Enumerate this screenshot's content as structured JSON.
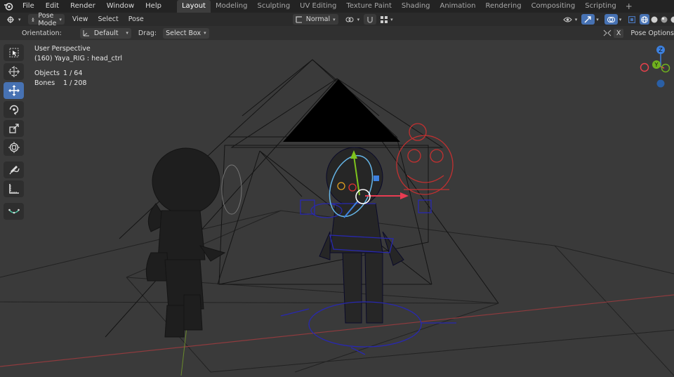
{
  "topbar": {
    "menus": [
      "File",
      "Edit",
      "Render",
      "Window",
      "Help"
    ],
    "tabs": [
      {
        "label": "Layout",
        "active": true
      },
      {
        "label": "Modeling",
        "active": false
      },
      {
        "label": "Sculpting",
        "active": false
      },
      {
        "label": "UV Editing",
        "active": false
      },
      {
        "label": "Texture Paint",
        "active": false
      },
      {
        "label": "Shading",
        "active": false
      },
      {
        "label": "Animation",
        "active": false
      },
      {
        "label": "Rendering",
        "active": false
      },
      {
        "label": "Compositing",
        "active": false
      },
      {
        "label": "Scripting",
        "active": false
      }
    ],
    "add_tab": "+"
  },
  "viewport_header": {
    "mode": "Pose Mode",
    "menus": [
      "View",
      "Select",
      "Pose"
    ],
    "transform_orientation": "Normal"
  },
  "tool_settings": {
    "orientation_label": "Orientation:",
    "orientation_value": "Default",
    "drag_label": "Drag:",
    "drag_value": "Select Box",
    "right_x": "X",
    "pose_options": "Pose Options"
  },
  "overlay": {
    "perspective": "User Perspective",
    "active_object": "(160) Yaya_RIG : head_ctrl",
    "objects_label": "Objects",
    "objects_value": "1 / 64",
    "bones_label": "Bones",
    "bones_value": "1 / 208"
  },
  "gizmo": {
    "z": "Z",
    "y": "Y"
  },
  "toolbar": {
    "tools": [
      "select-box",
      "cursor",
      "move",
      "rotate",
      "scale",
      "transform",
      "annotate",
      "measure",
      "pose-relax"
    ],
    "active": "move"
  },
  "colors": {
    "active_blue": "#4772b3",
    "viewport_bg": "#3a3a3a",
    "axis_x": "#e8414c",
    "axis_y": "#70b11e",
    "axis_z": "#3d81e0"
  }
}
